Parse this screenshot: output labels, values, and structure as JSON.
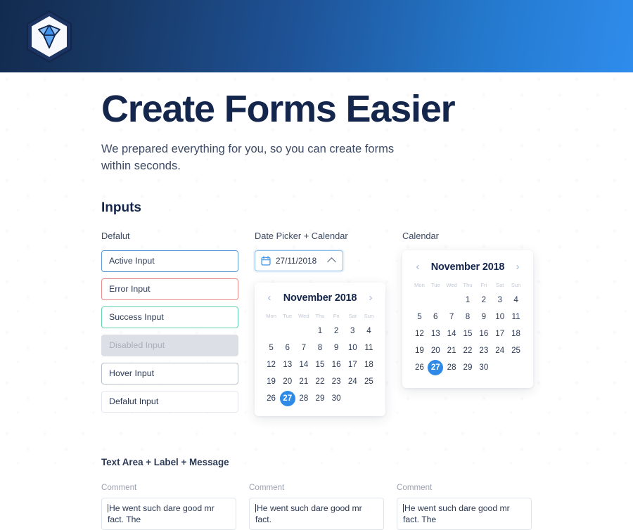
{
  "header": {
    "logo_name": "sketch-diamond-logo",
    "gradient_from": "#122a4f",
    "gradient_to": "#2f8cec"
  },
  "hero": {
    "title": "Create Forms Easier",
    "subtitle": "We prepared everything for you, so you can create forms within seconds."
  },
  "sections": {
    "inputs_heading": "Inputs",
    "textarea_heading": "Text Area + Label + Message"
  },
  "columns": {
    "inputs_label": "Defalut",
    "datepicker_label": "Date Picker + Calendar",
    "calendar_label": "Calendar"
  },
  "inputs": [
    {
      "value": "Active Input",
      "state": "active"
    },
    {
      "value": "Error Input",
      "state": "error"
    },
    {
      "value": "Success Input",
      "state": "success"
    },
    {
      "value": "Disabled Input",
      "state": "disabled"
    },
    {
      "value": "Hover Input",
      "state": "hover"
    },
    {
      "value": "Defalut Input",
      "state": "defalut"
    }
  ],
  "datepicker": {
    "value": "27/11/2018",
    "icon": "calendar-icon",
    "toggle_icon": "chevron-up-icon"
  },
  "calendar": {
    "title": "November 2018",
    "prev_icon": "chevron-left-icon",
    "next_icon": "chevron-right-icon",
    "weekdays": [
      "Mon",
      "Tue",
      "Wed",
      "Thu",
      "Fri",
      "Sat",
      "Sun"
    ],
    "lead_blanks": 3,
    "days": [
      1,
      2,
      3,
      4,
      5,
      6,
      7,
      8,
      9,
      10,
      11,
      12,
      13,
      14,
      15,
      16,
      17,
      18,
      19,
      20,
      21,
      22,
      23,
      24,
      25,
      26,
      27,
      28,
      29,
      30
    ],
    "selected_day": 27,
    "selected_color": "#2e8ae6"
  },
  "textareas": [
    {
      "label": "Comment",
      "value": "He went such dare good mr fact. The"
    },
    {
      "label": "Comment",
      "value": "He went such dare good mr fact."
    },
    {
      "label": "Comment",
      "value": "He went such dare good mr fact. The"
    }
  ],
  "colors": {
    "title": "#15264c",
    "active_border": "#5b9ada",
    "error_border": "#e98b8b",
    "success_border": "#5ed3ad",
    "disabled_bg": "#dcdfe5",
    "hover_border": "#b9bfca"
  }
}
